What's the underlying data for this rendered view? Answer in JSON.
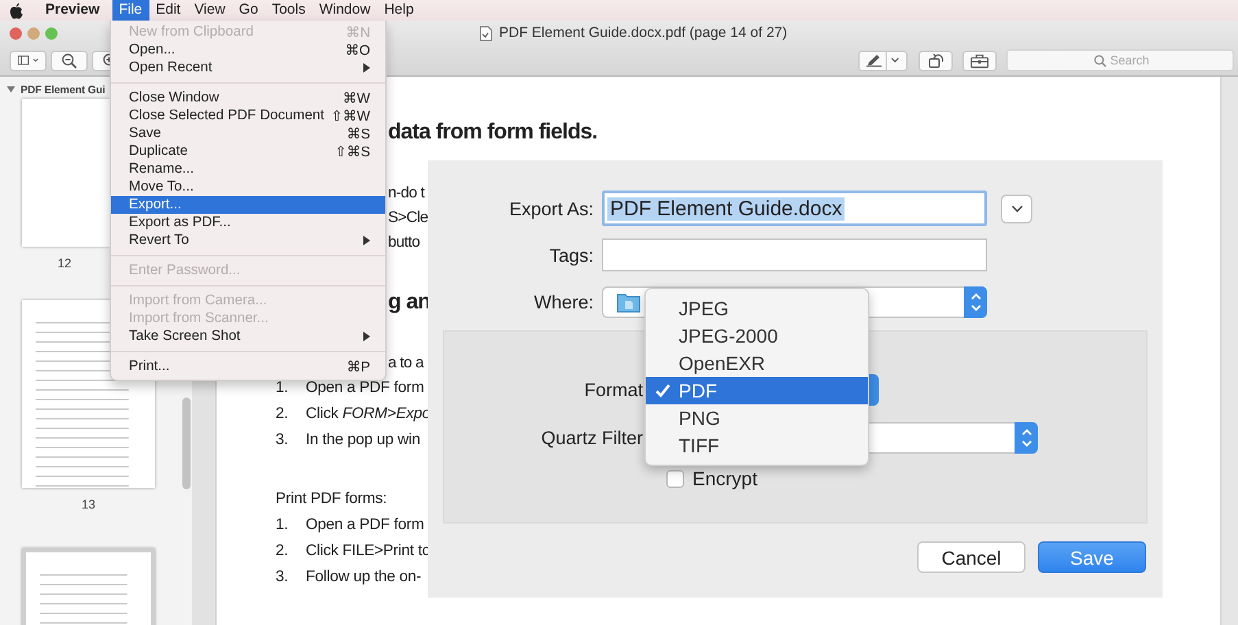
{
  "menu_bar": {
    "items": [
      {
        "label": "Preview",
        "kind": "app",
        "selected": false
      },
      {
        "label": "File",
        "kind": "menu",
        "selected": true
      },
      {
        "label": "Edit",
        "kind": "menu",
        "selected": false
      },
      {
        "label": "View",
        "kind": "menu",
        "selected": false
      },
      {
        "label": "Go",
        "kind": "menu",
        "selected": false
      },
      {
        "label": "Tools",
        "kind": "menu",
        "selected": false
      },
      {
        "label": "Window",
        "kind": "menu",
        "selected": false
      },
      {
        "label": "Help",
        "kind": "menu",
        "selected": false
      }
    ]
  },
  "window": {
    "title": "PDF Element Guide.docx.pdf (page 14 of 27)"
  },
  "toolbar": {
    "search": {
      "placeholder": "Search"
    }
  },
  "sidebar": {
    "header": {
      "label": "PDF Element Gui",
      "expanded": true
    },
    "thumbnails": [
      {
        "label": "12",
        "kind": "blank",
        "selected": false
      },
      {
        "label": "13",
        "kind": "text",
        "selected": false
      },
      {
        "kind": "text",
        "selected": true
      }
    ]
  },
  "document": {
    "blocks": [
      {
        "kind": "heading",
        "lines": [
          "data from form fields."
        ]
      },
      {
        "kind": "fragment",
        "lines": [
          "n-do t",
          "S>Cle",
          "butto"
        ]
      },
      {
        "kind": "heading",
        "lines": [
          "g an"
        ]
      },
      {
        "kind": "fragment",
        "lines": [
          "a to a"
        ]
      },
      {
        "kind": "list",
        "items": [
          {
            "number": "1.",
            "text": "Open a PDF form"
          },
          {
            "number": "2.",
            "text": "Click *FORM>Expo*"
          },
          {
            "number": "3.",
            "text": "In the pop up win"
          }
        ]
      },
      {
        "kind": "paragraph",
        "lines": [
          "Print PDF forms:"
        ]
      },
      {
        "kind": "list",
        "items": [
          {
            "number": "1.",
            "text": "Open a PDF form"
          },
          {
            "number": "2.",
            "text": "Click FILE>Print tc"
          },
          {
            "number": "3.",
            "text": "Follow up the on-"
          }
        ]
      }
    ]
  },
  "file_menu": {
    "items": [
      {
        "kind": "item",
        "label": "New from Clipboard",
        "shortcut": "⌘N",
        "disabled": true,
        "selected": false,
        "submenu": false
      },
      {
        "kind": "item",
        "label": "Open...",
        "shortcut": "⌘O",
        "disabled": false,
        "selected": false,
        "submenu": false
      },
      {
        "kind": "item",
        "label": "Open Recent",
        "disabled": false,
        "selected": false,
        "submenu": true
      },
      {
        "kind": "separator"
      },
      {
        "kind": "item",
        "label": "Close Window",
        "shortcut": "⌘W",
        "disabled": false,
        "selected": false,
        "submenu": false
      },
      {
        "kind": "item",
        "label": "Close Selected PDF Document",
        "shortcut": "⇧⌘W",
        "disabled": false,
        "selected": false,
        "submenu": false
      },
      {
        "kind": "item",
        "label": "Save",
        "shortcut": "⌘S",
        "disabled": false,
        "selected": false,
        "submenu": false
      },
      {
        "kind": "item",
        "label": "Duplicate",
        "shortcut": "⇧⌘S",
        "disabled": false,
        "selected": false,
        "submenu": false
      },
      {
        "kind": "item",
        "label": "Rename...",
        "disabled": false,
        "selected": false,
        "submenu": false
      },
      {
        "kind": "item",
        "label": "Move To...",
        "disabled": false,
        "selected": false,
        "submenu": false
      },
      {
        "kind": "item",
        "label": "Export...",
        "disabled": false,
        "selected": true,
        "submenu": false
      },
      {
        "kind": "item",
        "label": "Export as PDF...",
        "disabled": false,
        "selected": false,
        "submenu": false
      },
      {
        "kind": "item",
        "label": "Revert To",
        "disabled": false,
        "selected": false,
        "submenu": true
      },
      {
        "kind": "separator"
      },
      {
        "kind": "item",
        "label": "Enter Password...",
        "disabled": true,
        "selected": false,
        "submenu": false
      },
      {
        "kind": "separator"
      },
      {
        "kind": "item",
        "label": "Import from Camera...",
        "disabled": true,
        "selected": false,
        "submenu": false
      },
      {
        "kind": "item",
        "label": "Import from Scanner...",
        "disabled": true,
        "selected": false,
        "submenu": false
      },
      {
        "kind": "item",
        "label": "Take Screen Shot",
        "disabled": false,
        "selected": false,
        "submenu": true
      },
      {
        "kind": "separator"
      },
      {
        "kind": "item",
        "label": "Print...",
        "shortcut": "⌘P",
        "disabled": false,
        "selected": false,
        "submenu": false
      }
    ]
  },
  "export_dialog": {
    "export_as": {
      "label": "Export As:",
      "value": "PDF Element Guide.docx",
      "text_selected": true
    },
    "tags": {
      "label": "Tags:"
    },
    "where": {
      "label": "Where:"
    },
    "format": {
      "label": "Format"
    },
    "quartz_filter": {
      "label": "Quartz Filter"
    },
    "encrypt": {
      "label": "Encrypt",
      "checked": false
    },
    "buttons": [
      {
        "label": "Cancel",
        "kind": "normal"
      },
      {
        "label": "Save",
        "kind": "default"
      }
    ]
  },
  "format_popup": {
    "items": [
      {
        "label": "JPEG",
        "selected": false
      },
      {
        "label": "JPEG-2000",
        "selected": false
      },
      {
        "label": "OpenEXR",
        "selected": false
      },
      {
        "label": "PDF",
        "selected": true
      },
      {
        "label": "PNG",
        "selected": false
      },
      {
        "label": "TIFF",
        "selected": false
      }
    ]
  }
}
